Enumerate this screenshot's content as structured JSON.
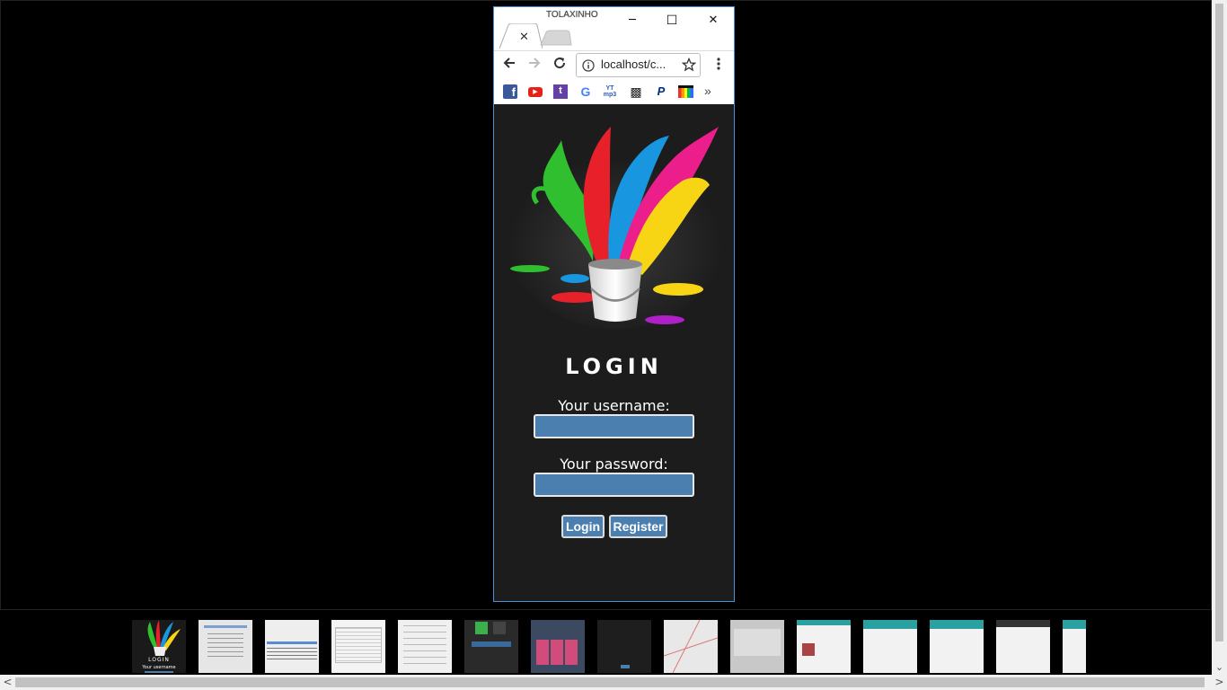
{
  "window": {
    "title": "TOLAXINHO",
    "minimize_glyph": "─",
    "maximize_glyph": "☐",
    "close_glyph": "✕"
  },
  "tabs": [
    {
      "close_glyph": "✕",
      "active": true
    },
    {
      "active": false
    }
  ],
  "toolbar": {
    "url": "localhost/c...",
    "icons": [
      "back-icon",
      "forward-icon",
      "reload-icon",
      "info-icon",
      "star-icon",
      "menu-icon"
    ]
  },
  "bookmarks": {
    "items": [
      {
        "name": "facebook",
        "glyph": "f",
        "color": "#3b5998"
      },
      {
        "name": "youtube",
        "glyph": "▶",
        "color": "#e62117"
      },
      {
        "name": "twitch",
        "glyph": "t",
        "color": "#6441a4"
      },
      {
        "name": "google",
        "glyph": "G",
        "color": "#4285f4"
      },
      {
        "name": "yt-mp3",
        "glyph": "YT mp3",
        "color": "#2a5bb5"
      },
      {
        "name": "game",
        "glyph": "▩",
        "color": "#222"
      },
      {
        "name": "paypal",
        "glyph": "P",
        "color": "#003087"
      },
      {
        "name": "shop",
        "glyph": "▦",
        "color": "#111"
      }
    ],
    "more_glyph": "»"
  },
  "page": {
    "heading": "LOGIN",
    "username_label": "Your username:",
    "password_label": "Your password:",
    "username_value": "",
    "password_value": "",
    "login_button": "Login",
    "register_button": "Register",
    "colors": {
      "background": "#1c1c1c",
      "input": "#4a7fb0",
      "button": "#4a7fb0"
    }
  },
  "filmstrip": {
    "thumbnails": [
      {
        "name": "login-splash",
        "caption": "LOGIN",
        "sub": "Your username",
        "bg": "#1a1a1a"
      },
      {
        "name": "document-list",
        "bg": "#e6e6e6"
      },
      {
        "name": "query-warning",
        "bg": "#eeeeee"
      },
      {
        "name": "code-editor",
        "bg": "#f4f4f4"
      },
      {
        "name": "form-page",
        "bg": "#f0f0f0"
      },
      {
        "name": "dark-app",
        "bg": "#2a2a2a"
      },
      {
        "name": "grid-tiles",
        "bg": "#3b4a60"
      },
      {
        "name": "dark-table",
        "bg": "#1e1e1e"
      },
      {
        "name": "map-view",
        "bg": "#e8e8e8"
      },
      {
        "name": "gray-page",
        "bg": "#c8c8c8"
      },
      {
        "name": "teal-app-1",
        "bg": "#f2f2f2"
      },
      {
        "name": "teal-app-2",
        "bg": "#f2f2f2"
      },
      {
        "name": "teal-app-3",
        "bg": "#f2f2f2"
      },
      {
        "name": "teal-app-4",
        "bg": "#f2f2f2"
      },
      {
        "name": "teal-app-5",
        "bg": "#f2f2f2"
      }
    ]
  },
  "scrollbars": {
    "left_arrow": "<",
    "right_arrow": ">",
    "down_arrow": "⌄"
  }
}
